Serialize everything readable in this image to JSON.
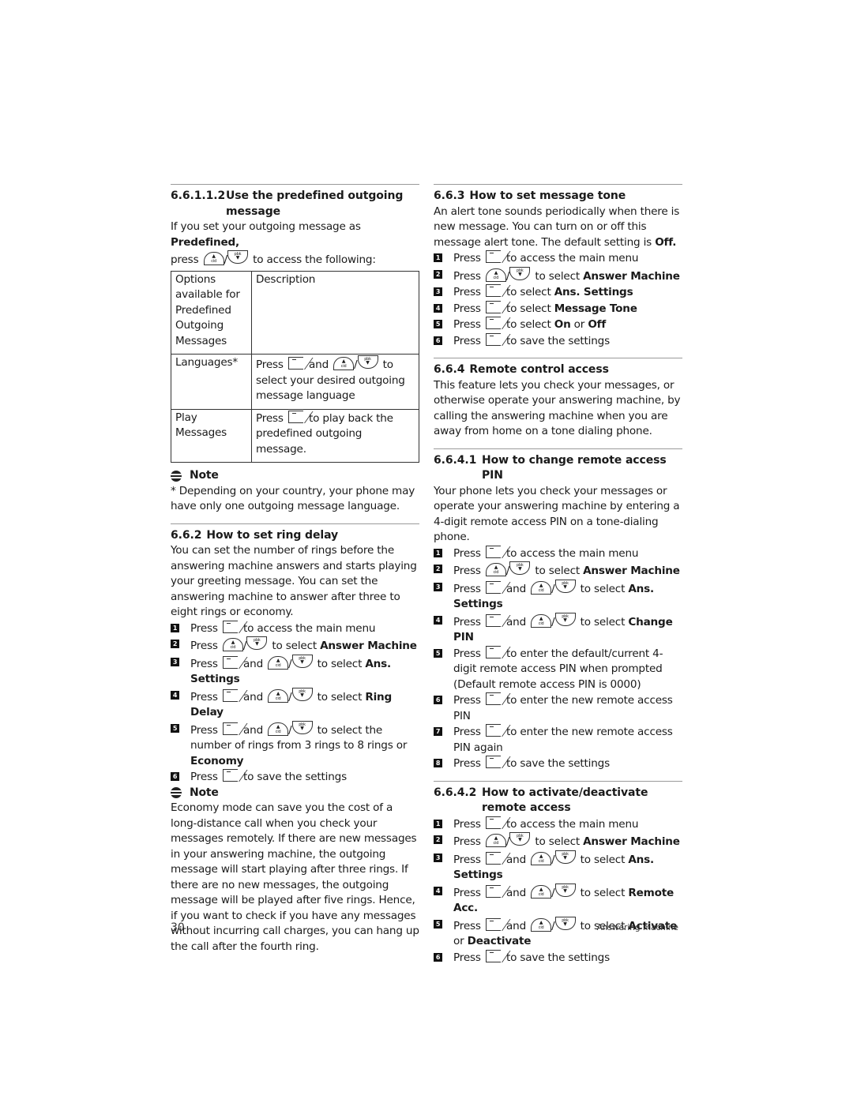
{
  "left": {
    "s1": {
      "number": "6.6.1.1.2",
      "title": "Use the predefined outgoing message",
      "intro_pre": "If you set your outgoing message as ",
      "intro_bold": "Predefined,",
      "intro_press": "press",
      "intro_post": " to access the following:",
      "table": {
        "header": [
          "Options available for Predefined Outgoing Messages",
          "Description"
        ],
        "rows": [
          {
            "option": "Languages*",
            "pre": "Press",
            "mid": " and ",
            "post": " to select your desired outgoing message language"
          },
          {
            "option": "Play Messages",
            "pre": "Press",
            "post": " to play back the predefined outgoing message."
          }
        ]
      },
      "note_title": "Note",
      "note_text": "* Depending on your country, your phone may have only one outgoing message language."
    },
    "s2": {
      "number": "6.6.2",
      "title": "How to set ring delay",
      "intro": "You can set the number of rings before the answering machine answers and starts playing your greeting message. You can set the answering machine to answer after three to eight rings or economy.",
      "steps": [
        {
          "n": "1",
          "pre": "Press",
          "post": " to access the main menu",
          "bold": ""
        },
        {
          "n": "2",
          "pre": "Press",
          "post": " to select ",
          "bold": "Answer Machine"
        },
        {
          "n": "3",
          "pre": "Press",
          "mid": " and ",
          "post": " to select ",
          "bold": "Ans. Settings"
        },
        {
          "n": "4",
          "pre": "Press",
          "mid": " and ",
          "post": " to select ",
          "bold": "Ring Delay"
        },
        {
          "n": "5",
          "pre": "Press",
          "mid": " and ",
          "post": " to select the number of rings from 3 rings to 8 rings or ",
          "bold": "Economy"
        },
        {
          "n": "6",
          "pre": "Press",
          "post": " to save the settings",
          "bold": ""
        }
      ],
      "note_title": "Note",
      "note_text": "Economy mode can save you the cost of a long-distance call when you check your messages remotely. If there are new messages in your answering machine, the outgoing message will start playing after three rings. If there are no new messages, the outgoing message will be played after five rings. Hence, if you want to check if you have any messages without incurring call charges, you can hang up the call after the fourth ring."
    }
  },
  "right": {
    "s3": {
      "number": "6.6.3",
      "title": "How to set message tone",
      "intro_pre": "An alert tone sounds periodically when there is new message.  You can turn on or off this message alert tone.  The default setting is ",
      "intro_bold": "Off.",
      "steps": [
        {
          "n": "1",
          "pre": "Press",
          "post": " to access the main menu",
          "bold": ""
        },
        {
          "n": "2",
          "pre": "Press",
          "post": " to select ",
          "bold": "Answer Machine"
        },
        {
          "n": "3",
          "pre": "Press",
          "post": " to select ",
          "bold": "Ans. Settings"
        },
        {
          "n": "4",
          "pre": "Press",
          "post": " to select ",
          "bold": "Message Tone"
        },
        {
          "n": "5",
          "pre": "Press",
          "post": " to select ",
          "bold": "On",
          "post2": " or ",
          "bold2": "Off"
        },
        {
          "n": "6",
          "pre": "Press",
          "post": " to save the settings",
          "bold": ""
        }
      ]
    },
    "s4": {
      "number": "6.6.4",
      "title": "Remote control access",
      "intro": "This feature lets you check your messages, or otherwise operate your answering machine, by calling the answering machine when you are away from home on a tone dialing phone."
    },
    "s41": {
      "number": "6.6.4.1",
      "title": "How to change remote access PIN",
      "intro": "Your phone lets you check your messages or operate your answering machine by entering a 4-digit remote access PIN on a tone-dialing phone.",
      "steps": [
        {
          "n": "1",
          "pre": "Press",
          "post": " to access the main menu",
          "bold": ""
        },
        {
          "n": "2",
          "pre": "Press",
          "post": " to select ",
          "bold": "Answer Machine"
        },
        {
          "n": "3",
          "pre": "Press",
          "mid": " and ",
          "post": " to select ",
          "bold": "Ans. Settings"
        },
        {
          "n": "4",
          "pre": "Press",
          "mid": " and ",
          "post": " to select ",
          "bold": "Change PIN"
        },
        {
          "n": "5",
          "pre": "Press",
          "post": " to enter the default/current 4-digit remote access PIN when prompted (Default remote access PIN is 0000)",
          "bold": ""
        },
        {
          "n": "6",
          "pre": "Press",
          "post": " to enter the new remote access PIN",
          "bold": ""
        },
        {
          "n": "7",
          "pre": "Press",
          "post": " to enter the new remote access PIN again",
          "bold": ""
        },
        {
          "n": "8",
          "pre": "Press",
          "post": " to save the settings",
          "bold": ""
        }
      ]
    },
    "s42": {
      "number": "6.6.4.2",
      "title": "How to activate/deactivate remote access",
      "steps": [
        {
          "n": "1",
          "pre": "Press",
          "post": " to access the main menu",
          "bold": ""
        },
        {
          "n": "2",
          "pre": "Press",
          "post": " to select ",
          "bold": "Answer Machine"
        },
        {
          "n": "3",
          "pre": "Press",
          "mid": " and ",
          "post": " to select ",
          "bold": "Ans. Settings"
        },
        {
          "n": "4",
          "pre": "Press",
          "mid": " and ",
          "post": " to select ",
          "bold": "Remote Acc."
        },
        {
          "n": "5",
          "pre": "Press",
          "mid": " and ",
          "post": " to select ",
          "bold": "Activate",
          "post2": " or ",
          "bold2": "Deactivate"
        },
        {
          "n": "6",
          "pre": "Press",
          "post": " to save the settings",
          "bold": ""
        }
      ]
    }
  },
  "footer": {
    "page_number": "30",
    "chapter": "Answering machine"
  },
  "icons": {
    "soft_key": "menu-softkey-icon",
    "nav_up": "nav-up-cid-icon",
    "nav_down": "nav-down-pbk-icon",
    "note": "note-icon"
  }
}
